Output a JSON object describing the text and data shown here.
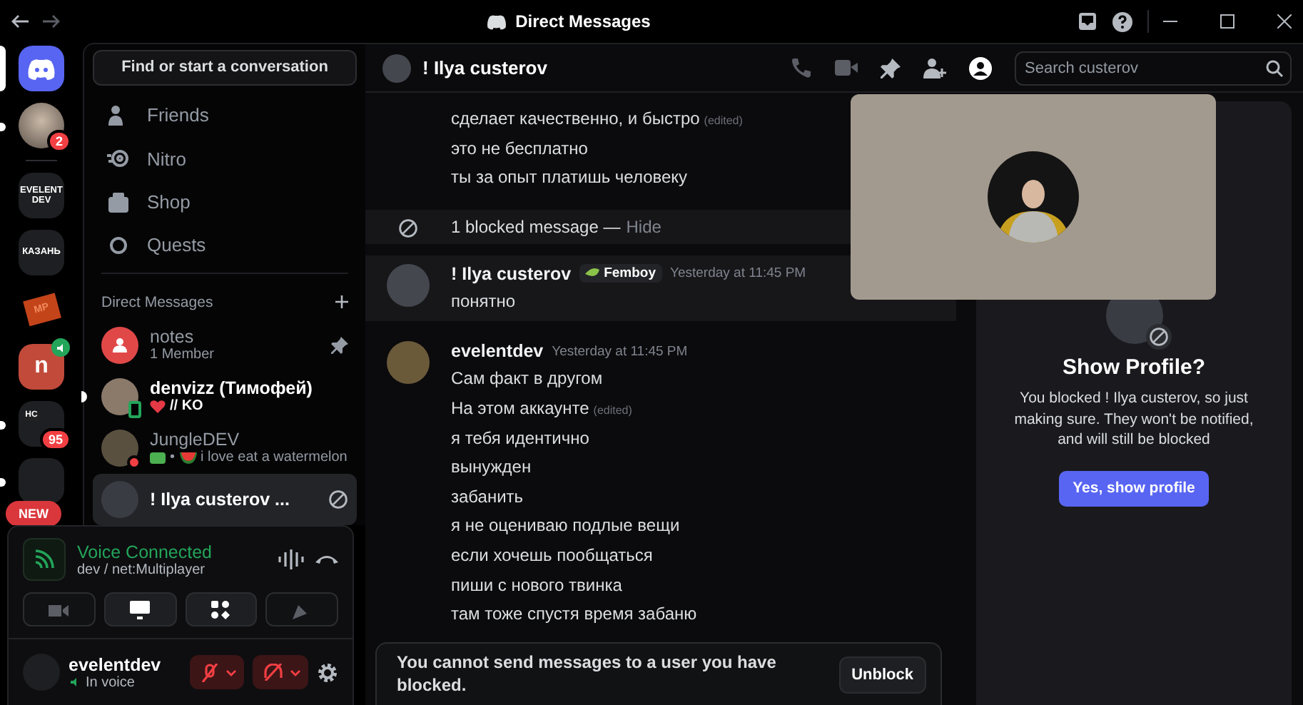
{
  "window": {
    "title": "Direct Messages"
  },
  "servers": [
    {
      "kind": "home",
      "selected": true,
      "unread": false
    },
    {
      "kind": "avatar",
      "badge": "2",
      "unread": true,
      "selected": false
    },
    {
      "kind": "label",
      "label": "EVELENT DEV",
      "unread": false,
      "selected": false
    },
    {
      "kind": "label",
      "label": "КАЗАНЬ",
      "unread": false,
      "selected": false
    },
    {
      "kind": "brick",
      "label": "MP",
      "unread": false,
      "selected": false
    },
    {
      "kind": "voice",
      "label": "n",
      "unread": false,
      "selected": false
    },
    {
      "kind": "folder",
      "label": "НС",
      "badge": "95",
      "unread": true,
      "selected": false
    },
    {
      "kind": "folder",
      "unread": true,
      "selected": false,
      "tag": "NEW"
    }
  ],
  "search_button": "Find or start a conversation",
  "nav": [
    {
      "kind": "friends",
      "label": "Friends"
    },
    {
      "kind": "nitro",
      "label": "Nitro"
    },
    {
      "kind": "shop",
      "label": "Shop"
    },
    {
      "kind": "quests",
      "label": "Quests"
    }
  ],
  "dm_header": "Direct Messages",
  "dms": [
    {
      "kind": "group",
      "name": "notes",
      "subtitle": "1 Member",
      "pinned": true,
      "unread": false,
      "selected": false
    },
    {
      "kind": "user",
      "name": "denvizz (Тимофей)",
      "status": "// KO",
      "pinned": false,
      "unread": true,
      "selected": false
    },
    {
      "kind": "user",
      "name": "JungleDEV",
      "status": "• i love eat a watermelon",
      "pinned": false,
      "unread": false,
      "selected": false
    },
    {
      "kind": "blocked",
      "name": "! Ilya custerov ...",
      "pinned": false,
      "unread": false,
      "selected": true
    }
  ],
  "voice": {
    "title": "Voice Connected",
    "channel": "dev / net:Multiplayer"
  },
  "user": {
    "name": "evelentdev",
    "status": "In voice",
    "muted": true,
    "deafened": true
  },
  "chat": {
    "name": "! Ilya custerov",
    "search": {
      "placeholder": "Search custerov"
    },
    "messages": [
      {
        "kind": "continuation",
        "lines": [
          {
            "text": "сделает качественно, и быстро",
            "edited": "(edited)"
          },
          {
            "text": "это не бесплатно"
          },
          {
            "text": "ты за опыт платишь человеку"
          }
        ]
      },
      {
        "kind": "blocked",
        "text": "1 blocked message —",
        "action": "Hide"
      },
      {
        "kind": "message",
        "author": "! Ilya custerov",
        "tag": "Femboy",
        "time": "Yesterday at 11:45 PM",
        "hovered": true,
        "lines": [
          {
            "text": "понятно"
          }
        ]
      },
      {
        "kind": "message",
        "author": "evelentdev",
        "time": "Yesterday at 11:45 PM",
        "hovered": false,
        "lines": [
          {
            "text": "Сам факт в другом"
          },
          {
            "text": "На этом аккаунте",
            "edited": "(edited)"
          },
          {
            "text": "я тебя идентично"
          },
          {
            "text": "вынужден"
          },
          {
            "text": "забанить"
          },
          {
            "text": "я не оцениваю подлые вещи"
          },
          {
            "text": "если хочешь пообщаться"
          },
          {
            "text": "пиши с нового твинка"
          },
          {
            "text": "там тоже спустя время забаню"
          }
        ]
      }
    ],
    "blocked_notice": "You cannot send messages to a user you have blocked.",
    "unblock": "Unblock"
  },
  "profile": {
    "title": "Show Profile?",
    "text": "You blocked ! Ilya custerov, so just making sure. They won't be notified, and will still be blocked",
    "button": "Yes, show profile"
  }
}
